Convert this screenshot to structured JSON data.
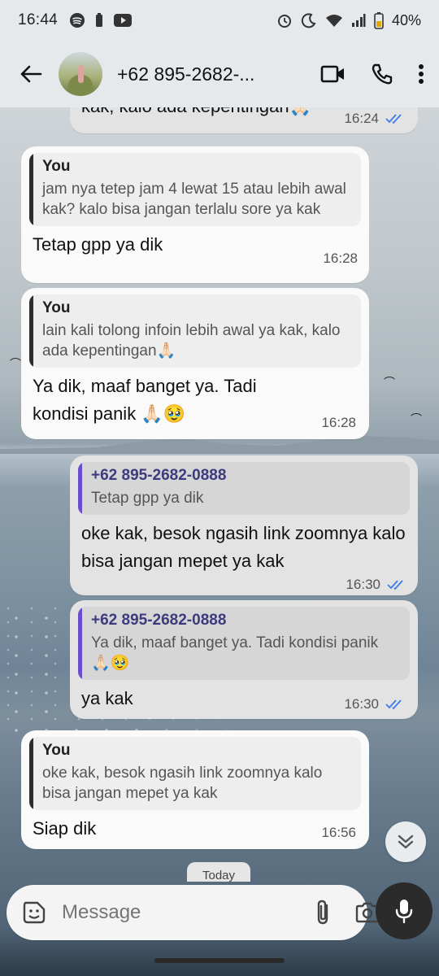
{
  "status_bar": {
    "time": "16:44",
    "battery": "40%",
    "left_icons": [
      "spotify-icon",
      "battery-saver-icon",
      "youtube-icon"
    ],
    "right_icons": [
      "alarm-icon",
      "dnd-moon-icon",
      "wifi-icon",
      "signal-icon",
      "battery-icon"
    ]
  },
  "header": {
    "contact_name": "+62 895-2682-...",
    "actions": [
      "video-call",
      "voice-call",
      "more-options"
    ]
  },
  "messages": [
    {
      "direction": "out",
      "text": "kak, kalo ada kepentingan🙏🏻",
      "time": "16:24",
      "read": true
    },
    {
      "direction": "in",
      "quote_author": "You",
      "quote_text": "jam nya tetep jam 4 lewat 15 atau lebih awal kak? kalo bisa jangan terlalu sore ya kak",
      "text": "Tetap gpp ya dik",
      "time": "16:28"
    },
    {
      "direction": "in",
      "quote_author": "You",
      "quote_text": "lain kali tolong infoin lebih awal ya kak, kalo ada kepentingan🙏🏻",
      "text": "Ya dik, maaf banget ya. Tadi kondisi panik 🙏🏻🥹",
      "time": "16:28"
    },
    {
      "direction": "out",
      "quote_author": "+62 895-2682-0888",
      "quote_text": "Tetap gpp ya dik",
      "text": "oke kak, besok ngasih link zoomnya kalo bisa jangan mepet ya kak",
      "time": "16:30",
      "read": true
    },
    {
      "direction": "out",
      "quote_author": "+62 895-2682-0888",
      "quote_text": "Ya dik, maaf banget ya. Tadi kondisi panik 🙏🏻🥹",
      "text": "ya kak",
      "time": "16:30",
      "read": true
    },
    {
      "direction": "in",
      "quote_author": "You",
      "quote_text": "oke kak, besok ngasih link zoomnya kalo bisa jangan mepet ya kak",
      "text": "Siap dik",
      "time": "16:56"
    }
  ],
  "date_chip": "Today",
  "composer": {
    "placeholder": "Message",
    "icons": [
      "sticker-icon",
      "attach-icon",
      "camera-icon",
      "mic-icon"
    ]
  },
  "colors": {
    "bar_bg": "#e6e9ec",
    "incoming_bubble": "#fafafa",
    "outgoing_bubble": "#e3e3e3",
    "read_tick": "#3b7be8",
    "quote_accent_self": "#2b2b2b",
    "quote_accent_other": "#6a4ccf"
  }
}
